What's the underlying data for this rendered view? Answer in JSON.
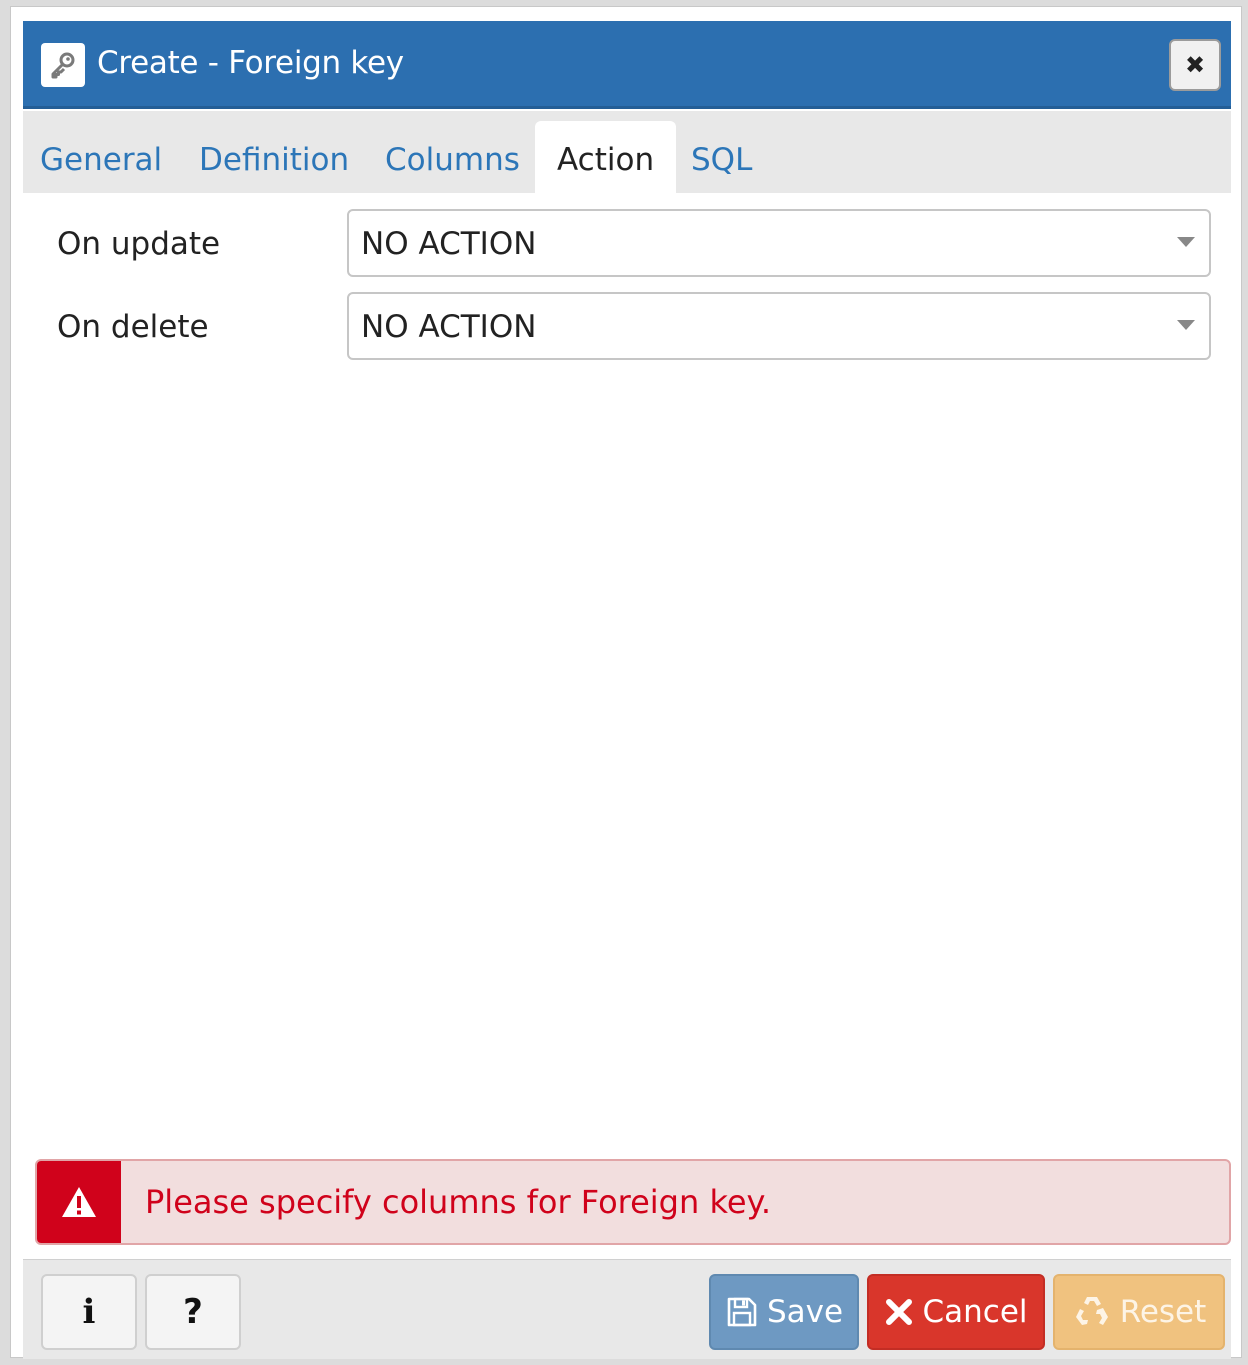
{
  "dialog": {
    "title": "Create - Foreign key",
    "title_icon": "key-icon",
    "close_icon": "close-icon",
    "close_glyph": "✖"
  },
  "tabs": [
    {
      "label": "General",
      "active": false
    },
    {
      "label": "Definition",
      "active": false
    },
    {
      "label": "Columns",
      "active": false
    },
    {
      "label": "Action",
      "active": true
    },
    {
      "label": "SQL",
      "active": false
    }
  ],
  "form": {
    "on_update": {
      "label": "On update",
      "value": "NO ACTION"
    },
    "on_delete": {
      "label": "On delete",
      "value": "NO ACTION"
    }
  },
  "alert": {
    "icon": "warning-icon",
    "message": "Please specify columns for Foreign key."
  },
  "footer": {
    "info_label": "i",
    "help_label": "?",
    "save_label": "Save",
    "cancel_label": "Cancel",
    "reset_label": "Reset"
  },
  "colors": {
    "titlebar": "#2c6fb0",
    "tab_link": "#2c76b8",
    "alert_text": "#d0021b",
    "alert_bg": "#f2dede",
    "save": "#6e99c2",
    "cancel": "#d9362b",
    "reset": "#f0c27f"
  }
}
